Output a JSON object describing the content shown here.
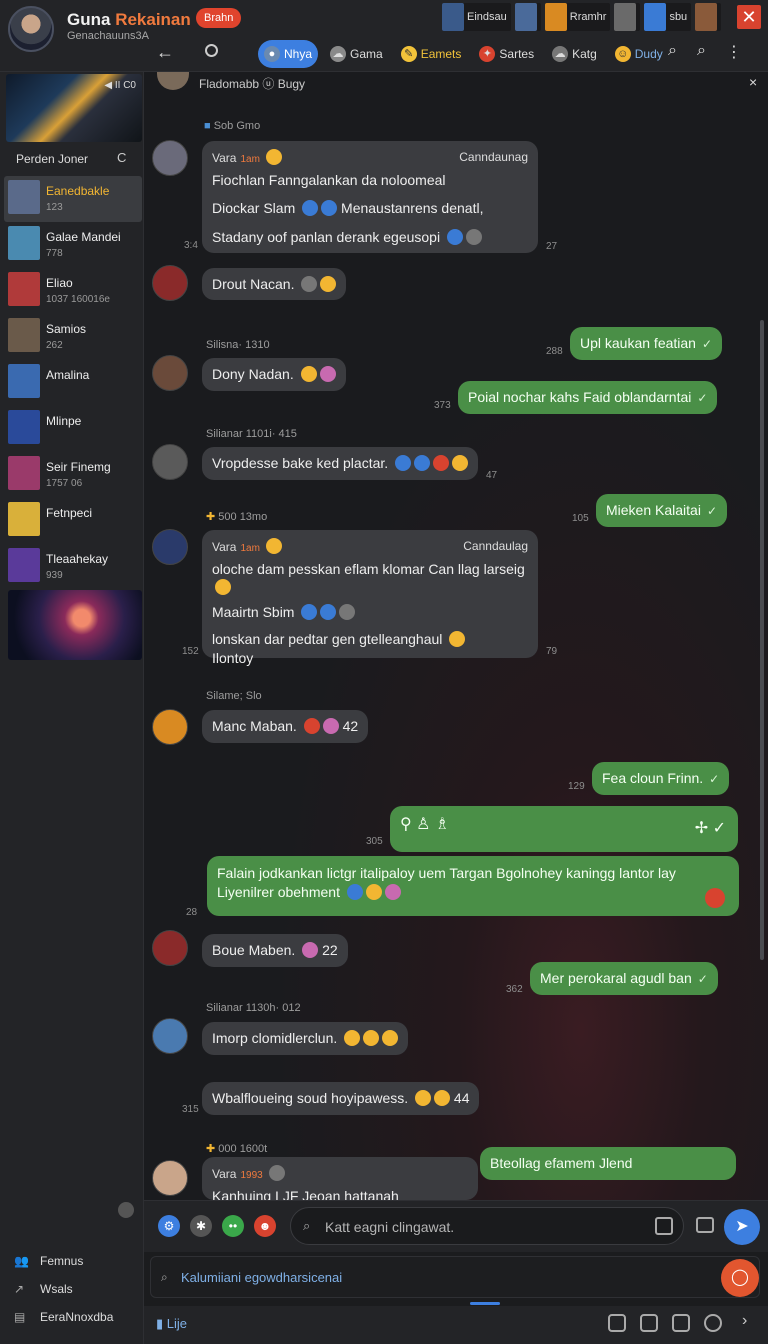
{
  "profile": {
    "name_a": "Guna",
    "name_b": "Rekainan",
    "subtitle": "Genachauuns3A",
    "badge": "Brahn"
  },
  "strip": [
    {
      "label": "Eindsau",
      "color": "#3a5a8a"
    },
    {
      "label": "",
      "color": "#4a6a9a"
    },
    {
      "label": "Rramhr",
      "color": "#d98a22"
    },
    {
      "label": "",
      "color": "#6a6a6a"
    },
    {
      "label": "sbu",
      "color": "#3a7bd5"
    },
    {
      "label": "",
      "color": "#8a5a3a"
    }
  ],
  "tabs": [
    {
      "label": "Nhya",
      "icon": "user-icon",
      "active": true
    },
    {
      "label": "Gama",
      "icon": "cloud-icon",
      "active": false
    },
    {
      "label": "Eamets",
      "icon": "pencil-icon",
      "active": false
    },
    {
      "label": "Sartes",
      "icon": "tag-icon",
      "active": false
    },
    {
      "label": "Katg",
      "icon": "cloud-icon",
      "active": false
    },
    {
      "label": "Dudy",
      "icon": "smile-icon",
      "active": false
    }
  ],
  "sidebar": {
    "banner_ctrl": "◀ II C0",
    "heading": "Perden Joner",
    "refresh": "C",
    "items": [
      {
        "title": "Eanedbakle",
        "meta": "123",
        "color": "#5a6a8a"
      },
      {
        "title": "Galae Mandei",
        "meta": "778",
        "color": "#4a8ab0"
      },
      {
        "title": "Eliao",
        "meta": "1037 160016e",
        "color": "#b03a3a"
      },
      {
        "title": "Samios",
        "meta": "262",
        "color": "#6a5a4a"
      },
      {
        "title": "Amalina",
        "meta": "",
        "color": "#3a6ab0"
      },
      {
        "title": "Mlinpe",
        "meta": "",
        "color": "#2a4a9a"
      },
      {
        "title": "Seir Finemg",
        "meta": "1757 06",
        "color": "#9a3a6a"
      },
      {
        "title": "Fetnpeci",
        "meta": "",
        "color": "#d9b03a"
      },
      {
        "title": "Tleaahekay",
        "meta": "939",
        "color": "#5a3a9a"
      }
    ],
    "footer": [
      {
        "label": "Femnus",
        "icon": "people-icon"
      },
      {
        "label": "Wsals",
        "icon": "share-icon"
      },
      {
        "label": "EeraNnoxdba",
        "icon": "box-icon"
      }
    ]
  },
  "pinned": {
    "text": "Fladomabb ⓤ Bugy",
    "close": "×"
  },
  "messages": {
    "m1": {
      "header": "Sob Gmo",
      "sender": "Vara",
      "tag": "1am",
      "right": "Canndaunag",
      "line1": "Fiochlan Fanngalankan da noloomeal",
      "line2": "Diockar Slam",
      "line2b": "Menaustanrens denatl,",
      "line3": "Stadany oof panlan derank egeusopi",
      "t_left": "3:4",
      "t_right": "27"
    },
    "m2": {
      "text": "Drout Nacan.",
      "t": ""
    },
    "m3": {
      "text": "Upl kaukan featian",
      "t": "288"
    },
    "m4": {
      "sender": "Silisna· 1310",
      "text": "Dony Nadan.",
      "t": ""
    },
    "m5": {
      "text": "Poial nochar kahs Faid oblandarntai",
      "t": "373"
    },
    "m6": {
      "sender": "Silianar 1101i· 415",
      "text": "Vropdesse bake ked plactar.",
      "t": "47"
    },
    "m7": {
      "text": "Mieken Kalaitai",
      "t": "105"
    },
    "m8": {
      "header": "500 13mo",
      "sender": "Vara",
      "tag": "1am",
      "right": "Canndaulag",
      "line1": "oloche dam pesskan eflam klomar Can llag larseig",
      "line2": "Maairtn Sbim",
      "line3": "lonskan dar pedtar gen gtelleanghaul",
      "line4": "Ilontoy",
      "t_left": "152",
      "t_right": "79"
    },
    "m9": {
      "sender": "Silame; Slo",
      "text": "Manc Maban.",
      "t": "42"
    },
    "m10": {
      "text": "Fea cloun Frinn.",
      "t": "129"
    },
    "m11": {
      "t": "305"
    },
    "m12": {
      "line1": "Falain jodkankan lictgr italipaloy uem Targan Bgolnohey kaningg lantor lay",
      "line2": "Liyenilrer obehment",
      "t": "28"
    },
    "m13": {
      "text": "Boue Maben.",
      "t": "22"
    },
    "m14": {
      "text": "Mer perokaral agudl ban",
      "t": "362"
    },
    "m15": {
      "sender": "Silianar 1130h· 012",
      "text": "Imorp clomidlerclun."
    },
    "m16": {
      "text": "Wbalfloueing soud hoyipawess.",
      "t": "315",
      "t2": "44"
    },
    "m17": {
      "header": "000 1600t",
      "sender": "Vara",
      "tag": "1993",
      "text": "Kanhuing I JF Jeoan hattanah frefileuana"
    },
    "m18": {
      "text": "Bteollag efamem Jlend"
    }
  },
  "composer": {
    "placeholder": "Katt eagni clingawat."
  },
  "search": {
    "placeholder": "Kalumiiani egowdharsicenai"
  },
  "bottom": {
    "label": "Lije"
  }
}
